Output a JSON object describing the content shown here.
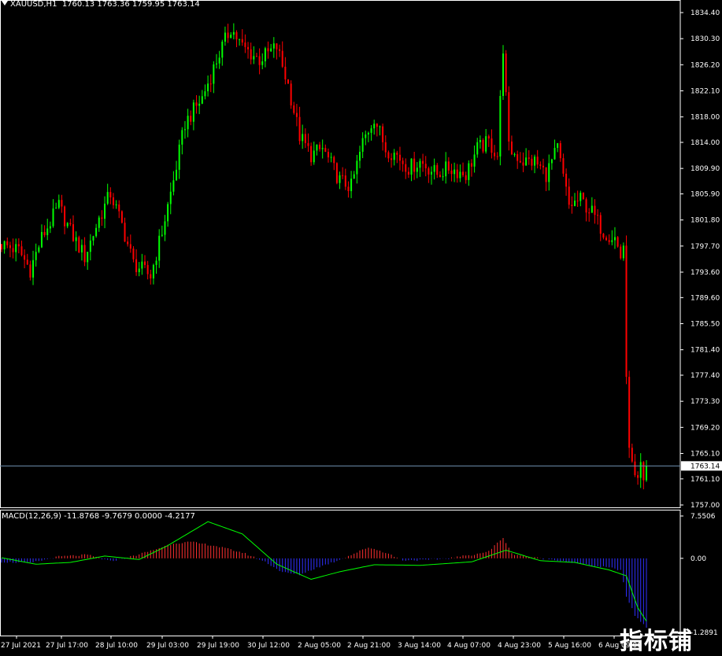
{
  "header": {
    "symbol": "XAUUSD,H1",
    "ohlc": "1760.13 1763.36 1759.95 1763.14"
  },
  "colors": {
    "background": "#000000",
    "bull": "#00ff00",
    "bear": "#ff0000",
    "axis": "#ffffff",
    "price_line": "#6f8fb0",
    "macd_pos": "#ff3030",
    "macd_neg": "#3030ff",
    "signal": "#00ff00"
  },
  "watermark": "指标铺",
  "chart_data": [
    {
      "type": "candlestick",
      "title": "XAUUSD,H1",
      "y_ticks": [
        1834.4,
        1830.3,
        1826.2,
        1822.1,
        1818.0,
        1814.0,
        1809.9,
        1805.9,
        1801.8,
        1797.7,
        1793.6,
        1789.6,
        1785.5,
        1781.4,
        1777.4,
        1773.3,
        1769.2,
        1765.1,
        1761.1,
        1757.0
      ],
      "y_tick_labels": [
        "1834.40",
        "1830.30",
        "1826.20",
        "1822.10",
        "1818.00",
        "1814.00",
        "1809.90",
        "1805.90",
        "1801.80",
        "1797.70",
        "1793.60",
        "1789.60",
        "1785.50",
        "1781.40",
        "1777.40",
        "1773.30",
        "1769.20",
        "1765.10",
        "1761.10",
        "1757.00"
      ],
      "ylim": [
        1756.5,
        1835.5
      ],
      "current_price": 1763.14,
      "current_price_label": "1763.14",
      "x_labels": [
        "27 Jul 2021",
        "27 Jul 17:00",
        "28 Jul 10:00",
        "29 Jul 03:00",
        "29 Jul 19:00",
        "30 Jul 12:00",
        "2 Aug 05:00",
        "2 Aug 21:00",
        "3 Aug 14:00",
        "4 Aug 07:00",
        "4 Aug 23:00",
        "5 Aug 16:00",
        "6 Aug 09:00"
      ],
      "waypoints": [
        [
          0,
          1798
        ],
        [
          6,
          1797
        ],
        [
          10,
          1794
        ],
        [
          14,
          1799
        ],
        [
          20,
          1804
        ],
        [
          24,
          1800
        ],
        [
          29,
          1796
        ],
        [
          34,
          1802
        ],
        [
          38,
          1806
        ],
        [
          42,
          1801
        ],
        [
          46,
          1795
        ],
        [
          52,
          1793
        ],
        [
          56,
          1800
        ],
        [
          60,
          1808
        ],
        [
          64,
          1817
        ],
        [
          70,
          1821
        ],
        [
          76,
          1828
        ],
        [
          80,
          1832
        ],
        [
          84,
          1829
        ],
        [
          90,
          1827
        ],
        [
          96,
          1829
        ],
        [
          100,
          1823
        ],
        [
          104,
          1815
        ],
        [
          108,
          1812
        ],
        [
          112,
          1813
        ],
        [
          118,
          1808
        ],
        [
          122,
          1807
        ],
        [
          126,
          1814
        ],
        [
          130,
          1818
        ],
        [
          134,
          1813
        ],
        [
          138,
          1812
        ],
        [
          142,
          1810
        ],
        [
          146,
          1811
        ],
        [
          152,
          1809
        ],
        [
          156,
          1810
        ],
        [
          162,
          1809
        ],
        [
          166,
          1813
        ],
        [
          170,
          1814
        ],
        [
          173,
          1812
        ],
        [
          175,
          1829
        ],
        [
          177,
          1813
        ],
        [
          182,
          1811
        ],
        [
          186,
          1811
        ],
        [
          190,
          1809
        ],
        [
          194,
          1813
        ],
        [
          198,
          1804
        ],
        [
          202,
          1805
        ],
        [
          206,
          1803
        ],
        [
          210,
          1800
        ],
        [
          214,
          1799
        ],
        [
          216,
          1796
        ],
        [
          217,
          1798
        ],
        [
          218,
          1776
        ],
        [
          219,
          1767
        ],
        [
          220,
          1763
        ],
        [
          221,
          1761
        ],
        [
          222,
          1760
        ],
        [
          223,
          1763
        ],
        [
          224,
          1760
        ],
        [
          225,
          1763
        ]
      ]
    },
    {
      "type": "macd",
      "label": "MACD(12,26,9) -11.8768 -9.7679 0.0000 -4.2177",
      "y_tick_labels": [
        "7.5506",
        "0.00",
        "-1.2891"
      ],
      "macd_waypoints": [
        [
          0,
          -0.6
        ],
        [
          10,
          -0.8
        ],
        [
          20,
          0.3
        ],
        [
          30,
          0.6
        ],
        [
          38,
          -0.5
        ],
        [
          46,
          0.4
        ],
        [
          54,
          1.6
        ],
        [
          60,
          2.6
        ],
        [
          66,
          2.8
        ],
        [
          74,
          2.2
        ],
        [
          84,
          1.0
        ],
        [
          92,
          -0.6
        ],
        [
          98,
          -2.4
        ],
        [
          104,
          -2.8
        ],
        [
          110,
          -1.6
        ],
        [
          116,
          -0.6
        ],
        [
          122,
          0.6
        ],
        [
          128,
          1.9
        ],
        [
          134,
          1.0
        ],
        [
          140,
          -0.3
        ],
        [
          148,
          -0.3
        ],
        [
          156,
          0.0
        ],
        [
          164,
          0.6
        ],
        [
          170,
          1.2
        ],
        [
          175,
          3.6
        ],
        [
          178,
          0.8
        ],
        [
          186,
          0.1
        ],
        [
          194,
          -0.3
        ],
        [
          200,
          -0.8
        ],
        [
          206,
          -1.3
        ],
        [
          212,
          -1.6
        ],
        [
          216,
          -2.0
        ],
        [
          218,
          -6.5
        ],
        [
          221,
          -9.8
        ],
        [
          225,
          -11.9
        ]
      ],
      "signal_waypoints": [
        [
          0,
          0.1
        ],
        [
          12,
          -1.0
        ],
        [
          24,
          -0.7
        ],
        [
          36,
          0.4
        ],
        [
          48,
          -0.2
        ],
        [
          58,
          2.2
        ],
        [
          72,
          6.3
        ],
        [
          84,
          4.2
        ],
        [
          96,
          -1.0
        ],
        [
          108,
          -3.6
        ],
        [
          118,
          -2.3
        ],
        [
          130,
          -1.1
        ],
        [
          146,
          -1.2
        ],
        [
          164,
          -0.6
        ],
        [
          176,
          1.4
        ],
        [
          188,
          -0.4
        ],
        [
          200,
          -0.7
        ],
        [
          212,
          -2.0
        ],
        [
          218,
          -3.0
        ],
        [
          222,
          -8.5
        ],
        [
          225,
          -10.8
        ]
      ]
    }
  ]
}
